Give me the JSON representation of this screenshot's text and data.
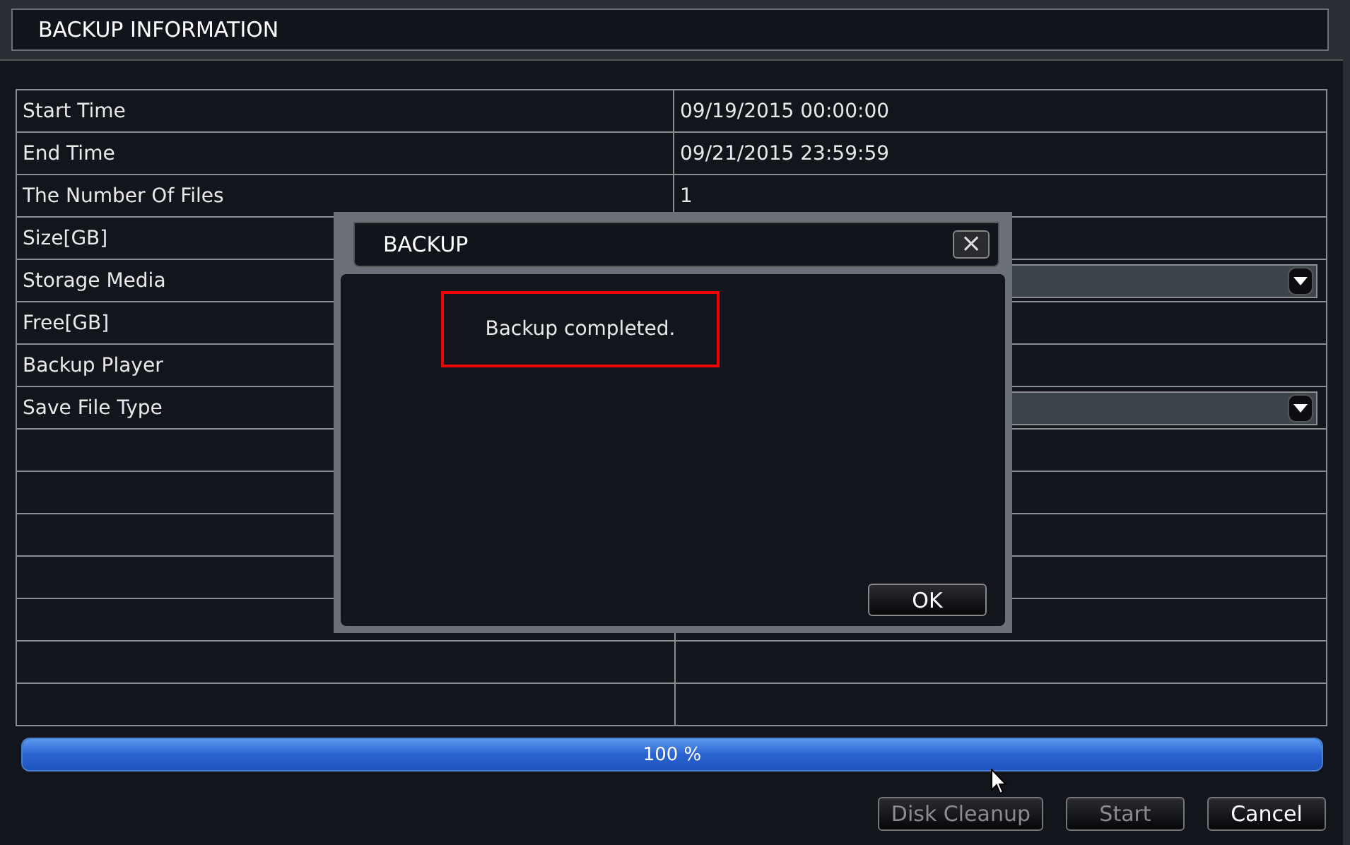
{
  "window": {
    "title": "BACKUP INFORMATION"
  },
  "fields": [
    {
      "label": "Start Time",
      "kind": "text",
      "value": "09/19/2015 00:00:00"
    },
    {
      "label": "End Time",
      "kind": "text",
      "value": "09/21/2015 23:59:59"
    },
    {
      "label": "The Number Of Files",
      "kind": "text",
      "value": "1"
    },
    {
      "label": "Size[GB]",
      "kind": "text"
    },
    {
      "label": "Storage Media",
      "kind": "select"
    },
    {
      "label": "Free[GB]",
      "kind": "text"
    },
    {
      "label": "Backup Player",
      "kind": "text"
    },
    {
      "label": "Save File Type",
      "kind": "select"
    }
  ],
  "progress": {
    "level": 1,
    "reading": "100 %"
  },
  "buttons": [
    {
      "label": "Disk Cleanup",
      "disabled": true
    },
    {
      "label": "Start",
      "disabled": true
    },
    {
      "label": "Cancel",
      "disabled": false
    }
  ],
  "dialog": {
    "title": "BACKUP",
    "close": "×",
    "message": "Backup completed.",
    "highlighted": true,
    "button": "OK"
  }
}
